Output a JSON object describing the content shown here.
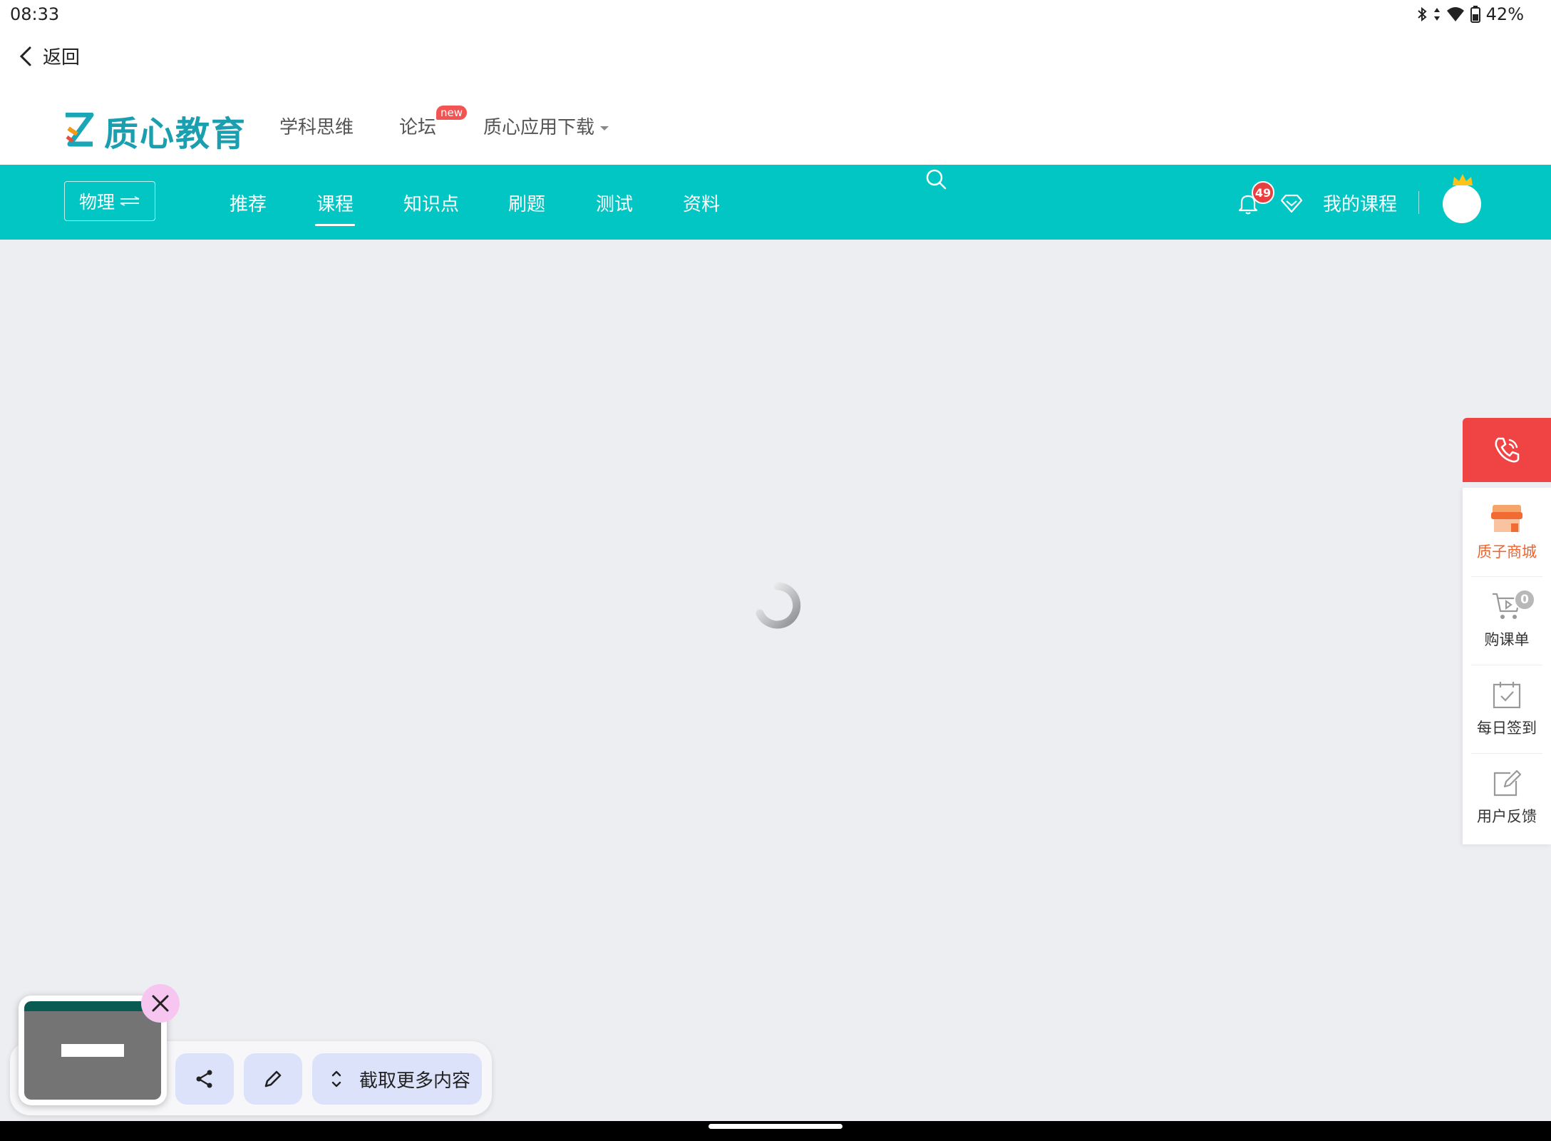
{
  "status_bar": {
    "time": "08:33",
    "battery": "42%"
  },
  "back": {
    "label": "返回"
  },
  "header": {
    "logo_text": "质心教育",
    "nav": [
      {
        "label": "学科思维"
      },
      {
        "label": "论坛",
        "badge": "new"
      },
      {
        "label": "质心应用下载"
      }
    ]
  },
  "main_nav": {
    "subject_label": "物理",
    "items": [
      {
        "label": "推荐"
      },
      {
        "label": "课程",
        "active": true
      },
      {
        "label": "知识点"
      },
      {
        "label": "刷题"
      },
      {
        "label": "测试"
      },
      {
        "label": "资料"
      }
    ],
    "notification_count": "49",
    "my_courses_label": "我的课程"
  },
  "side_panel": {
    "items": [
      {
        "label": "质子商城",
        "icon": "shop-icon"
      },
      {
        "label": "购课单",
        "icon": "cart-icon",
        "badge": "0"
      },
      {
        "label": "每日签到",
        "icon": "calendar-check-icon"
      },
      {
        "label": "用户反馈",
        "icon": "edit-icon"
      }
    ]
  },
  "screenshot_toolbar": {
    "scroll_capture_label": "截取更多内容"
  },
  "colors": {
    "teal": "#02c6c3",
    "logo": "#1a9fb0",
    "phone": "#f04444",
    "badge": "#e84040",
    "shop": "#f2622c"
  }
}
